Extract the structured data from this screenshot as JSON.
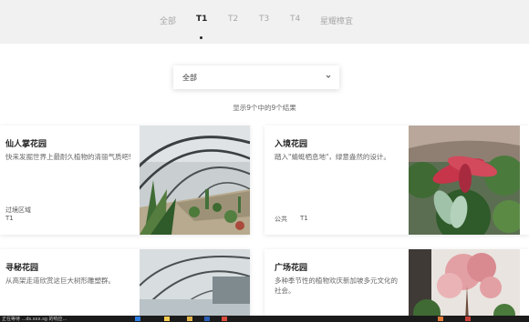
{
  "tabs": [
    {
      "label": "全部",
      "active": false
    },
    {
      "label": "T1",
      "active": true
    },
    {
      "label": "T2",
      "active": false
    },
    {
      "label": "T3",
      "active": false
    },
    {
      "label": "T4",
      "active": false
    },
    {
      "label": "星耀樟宜",
      "active": false
    }
  ],
  "filter": {
    "selected": "全部",
    "icon": "chevron-down-icon"
  },
  "results_text": "显示9个中的9个结果",
  "cards": [
    {
      "title": "仙人掌花园",
      "desc": "快来发掘世界上最耐久植物的清丽气质吧!",
      "area_label": "过境区域",
      "terminal": "T1"
    },
    {
      "title": "入境花园",
      "desc": "踏入\"蜻蜓栖息地\"，绿意盎然的设计。",
      "area_label": "公共",
      "terminal": "T1"
    },
    {
      "title": "寻秘花园",
      "desc": "从高架走道欣赏这巨大树形雕塑群。",
      "area_label": "",
      "terminal": ""
    },
    {
      "title": "广场花园",
      "desc": "多种季节性的植物欢庆新加坡多元文化的社会。",
      "area_label": "",
      "terminal": ""
    }
  ],
  "taskbar": {
    "text": "正在等待 ...ds.xxx.sg 的响应..."
  },
  "colors": {
    "accent_dark": "#222222",
    "muted": "#a8a8a8",
    "taskbar": "#1b1b1b"
  }
}
